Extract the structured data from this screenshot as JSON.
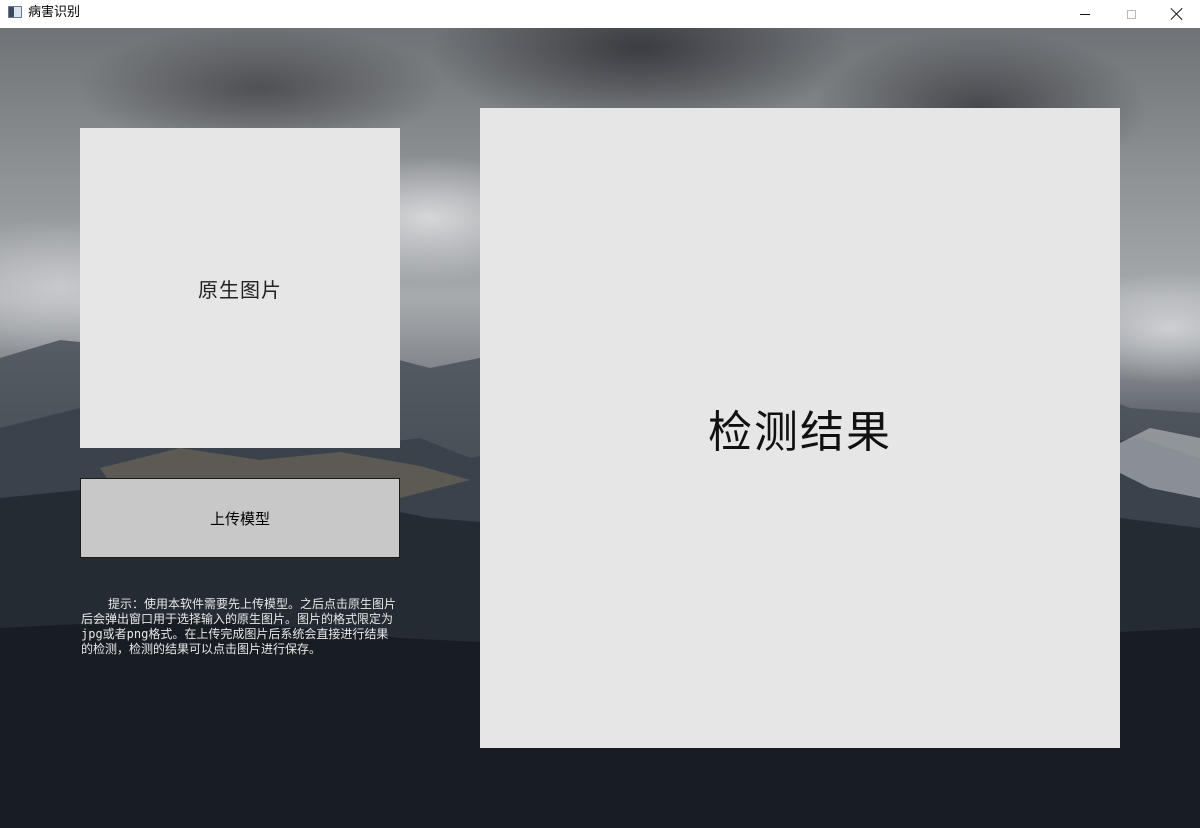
{
  "window": {
    "title": "病害识别",
    "icon": "app-window-icon",
    "controls": {
      "minimize_icon": "minimize-icon",
      "maximize_icon": "maximize-icon",
      "close_icon": "close-icon"
    }
  },
  "main": {
    "original_image_label": "原生图片",
    "upload_button_label": "上传模型",
    "hint_text": "提示：使用本软件需要先上传模型。之后点击原生图片后会弹出窗口用于选择输入的原生图片。图片的格式限定为jpg或者png格式。在上传完成图片后系统会直接进行结果的检测，检测的结果可以点击图片进行保存。",
    "result_label": "检测结果"
  },
  "colors": {
    "panel_background": "#e6e6e6",
    "button_background": "#c8c8c8",
    "hint_text_color": "#e8e8e8"
  }
}
